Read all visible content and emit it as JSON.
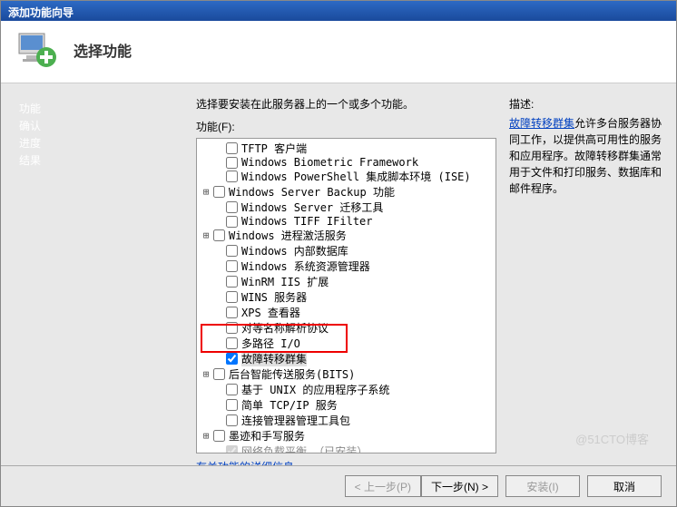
{
  "window": {
    "title": "添加功能向导"
  },
  "header": {
    "title": "选择功能"
  },
  "sidebar": {
    "items": [
      {
        "label": "功能",
        "active": true
      },
      {
        "label": "确认"
      },
      {
        "label": "进度"
      },
      {
        "label": "结果"
      }
    ]
  },
  "main": {
    "instruction": "选择要安装在此服务器上的一个或多个功能。",
    "features_label": "功能(F):",
    "details_link": "有关功能的详细信息",
    "features": [
      {
        "label": "TFTP 客户端",
        "indent": true
      },
      {
        "label": "Windows Biometric Framework",
        "indent": true
      },
      {
        "label": "Windows PowerShell 集成脚本环境 (ISE)",
        "indent": true
      },
      {
        "label": "Windows Server Backup 功能",
        "expand": "+"
      },
      {
        "label": "Windows Server 迁移工具",
        "indent": true
      },
      {
        "label": "Windows TIFF IFilter",
        "indent": true
      },
      {
        "label": "Windows 进程激活服务",
        "expand": "+"
      },
      {
        "label": "Windows 内部数据库",
        "indent": true
      },
      {
        "label": "Windows 系统资源管理器",
        "indent": true
      },
      {
        "label": "WinRM IIS 扩展",
        "indent": true
      },
      {
        "label": "WINS 服务器",
        "indent": true
      },
      {
        "label": "XPS 查看器",
        "indent": true
      },
      {
        "label": "对等名称解析协议",
        "indent": true
      },
      {
        "label": "多路径 I/O",
        "indent": true
      },
      {
        "label": "故障转移群集",
        "indent": true,
        "checked": true,
        "highlighted": true
      },
      {
        "label": "后台智能传送服务(BITS)",
        "expand": "+"
      },
      {
        "label": "基于 UNIX 的应用程序子系统",
        "indent": true
      },
      {
        "label": "简单 TCP/IP 服务",
        "indent": true
      },
      {
        "label": "连接管理器管理工具包",
        "indent": true
      },
      {
        "label": "墨迹和手写服务",
        "expand": "+"
      },
      {
        "label": "网络负载平衡  （已安装）",
        "indent": true,
        "checked": true,
        "disabled": true
      }
    ]
  },
  "description": {
    "label": "描述:",
    "link_text": "故障转移群集",
    "text": "允许多台服务器协同工作，以提供高可用性的服务和应用程序。故障转移群集通常用于文件和打印服务、数据库和邮件程序。"
  },
  "footer": {
    "prev": "< 上一步(P)",
    "next": "下一步(N) >",
    "install": "安装(I)",
    "cancel": "取消"
  },
  "watermark": "@51CTO博客"
}
